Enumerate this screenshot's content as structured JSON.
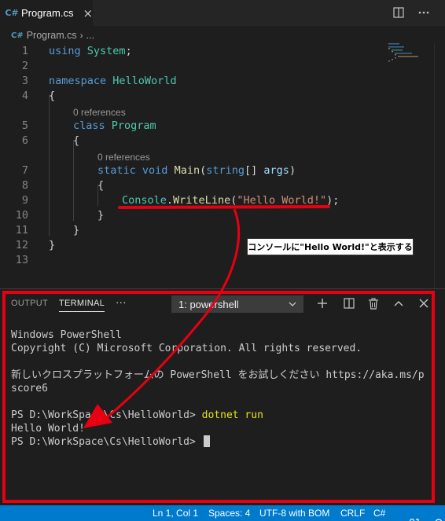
{
  "tab": {
    "label": "Program.cs",
    "icon": "csharp-file-icon",
    "close": "×"
  },
  "breadcrumb": {
    "file": "Program.cs",
    "more": "..."
  },
  "editor": {
    "line_numbers": [
      "1",
      "2",
      "3",
      "4",
      "5",
      "6",
      "7",
      "8",
      "9",
      "10",
      "11",
      "12",
      "13"
    ],
    "codelens": {
      "class_refs": "0 references",
      "method_refs": "0 references"
    },
    "code": {
      "using_kw": "using",
      "using_ns": "System",
      "semicolon": ";",
      "namespace_kw": "namespace",
      "namespace_name": "HelloWorld",
      "open_brace": "{",
      "close_brace": "}",
      "class_kw": "class",
      "class_name": "Program",
      "static_kw": "static",
      "void_kw": "void",
      "main_name": "Main",
      "paren_open": "(",
      "string_kw": "string",
      "brackets": "[]",
      "args": "args",
      "paren_close": ")",
      "console": "Console",
      "dot": ".",
      "writeline": "WriteLine",
      "hello_literal": "\"Hello World!\"",
      "call_end": ");"
    }
  },
  "annotation": {
    "callout": "コンソールに\"Hello World!\"と表示する",
    "color": "#e60012"
  },
  "panel": {
    "tabs": {
      "output": "OUTPUT",
      "terminal": "TERMINAL",
      "more": "···"
    },
    "terminal_select": "1: powershell",
    "terminal_lines": [
      "Windows PowerShell",
      "Copyright (C) Microsoft Corporation. All rights reserved.",
      "",
      "新しいクロスプラットフォームの PowerShell をお試しください https://aka.ms/p",
      "score6",
      ""
    ],
    "prompt": "PS D:\\WorkSpace\\Cs\\HelloWorld> ",
    "command": "dotnet run",
    "output": "Hello World!",
    "prompt2": "PS D:\\WorkSpace\\Cs\\HelloWorld> "
  },
  "statusbar": {
    "position": "Ln 1, Col 1",
    "spaces": "Spaces: 4",
    "encoding": "UTF-8 with BOM",
    "eol": "CRLF",
    "language": "C#",
    "accent": "#007acc"
  }
}
